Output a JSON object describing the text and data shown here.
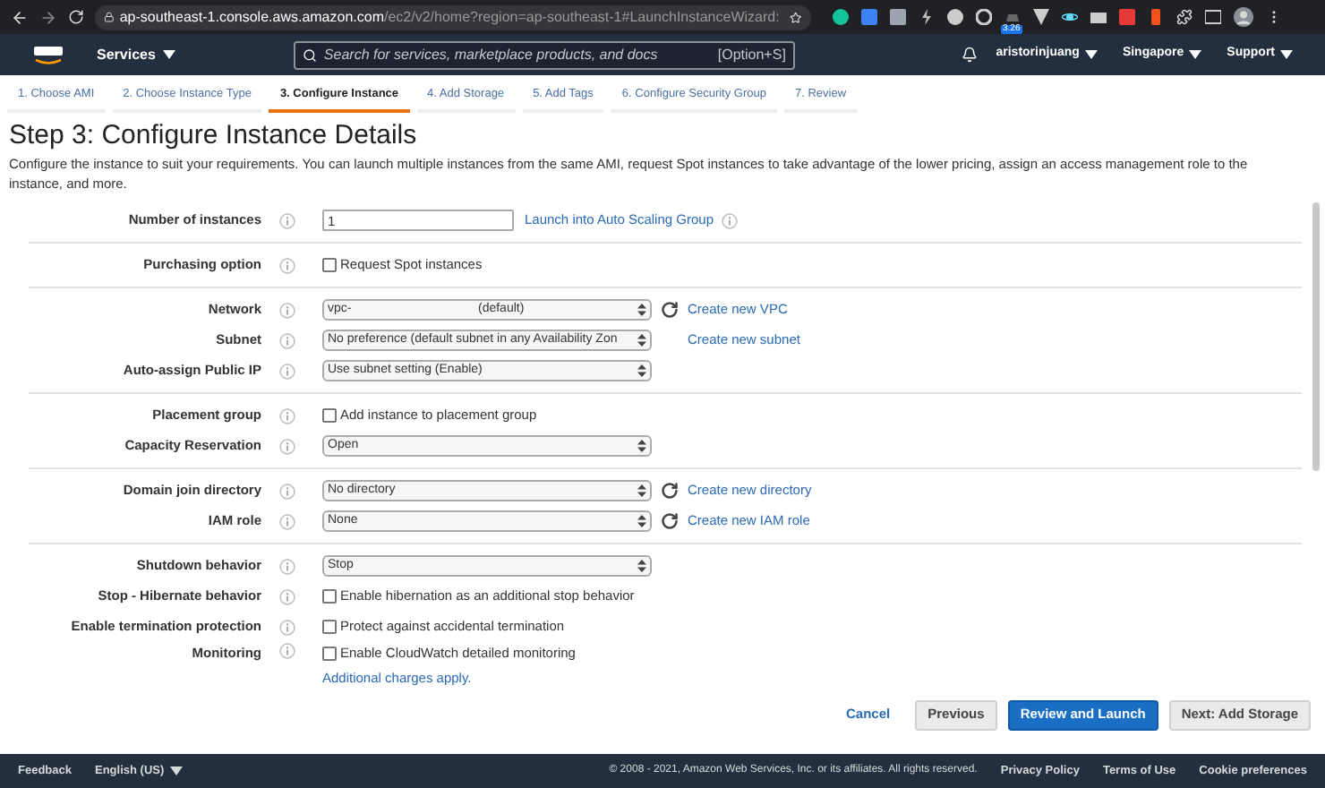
{
  "browser": {
    "url_host": "ap-southeast-1.console.aws.amazon.com",
    "url_path": "/ec2/v2/home?region=ap-southeast-1#LaunchInstanceWizard:",
    "extension_badge": "3.26"
  },
  "top_nav": {
    "services": "Services",
    "search_placeholder": "Search for services, marketplace products, and docs",
    "search_shortcut": "[Option+S]",
    "user": "aristorinjuang",
    "region": "Singapore",
    "support": "Support"
  },
  "wizard_steps": [
    {
      "label": "1. Choose AMI",
      "selected": false
    },
    {
      "label": "2. Choose Instance Type",
      "selected": false
    },
    {
      "label": "3. Configure Instance",
      "selected": true
    },
    {
      "label": "4. Add Storage",
      "selected": false
    },
    {
      "label": "5. Add Tags",
      "selected": false
    },
    {
      "label": "6. Configure Security Group",
      "selected": false
    },
    {
      "label": "7. Review",
      "selected": false
    }
  ],
  "title": "Step 3: Configure Instance Details",
  "description": "Configure the instance to suit your requirements. You can launch multiple instances from the same AMI, request Spot instances to take advantage of the lower pricing, assign an access management role to the instance, and more.",
  "sections": [
    {
      "rows": [
        {
          "label": "Number of instances",
          "kind": "input",
          "value": "1",
          "link": "Launch into Auto Scaling Group",
          "link_info": true
        }
      ]
    },
    {
      "rows": [
        {
          "label": "Purchasing option",
          "kind": "checkbox",
          "text": "Request Spot instances",
          "checked": false
        }
      ]
    },
    {
      "rows": [
        {
          "label": "Network",
          "kind": "select",
          "value": "vpc-",
          "value_suffix": "(default)",
          "refresh": true,
          "link": "Create new VPC"
        },
        {
          "label": "Subnet",
          "kind": "select",
          "value": "No preference (default subnet in any Availability Zon",
          "refresh": false,
          "link": "Create new subnet"
        },
        {
          "label": "Auto-assign Public IP",
          "kind": "select",
          "value": "Use subnet setting (Enable)",
          "refresh": false
        }
      ]
    },
    {
      "rows": [
        {
          "label": "Placement group",
          "kind": "checkbox",
          "text": "Add instance to placement group",
          "checked": false
        },
        {
          "label": "Capacity Reservation",
          "kind": "select",
          "value": "Open",
          "refresh": false
        }
      ]
    },
    {
      "rows": [
        {
          "label": "Domain join directory",
          "kind": "select",
          "value": "No directory",
          "refresh": true,
          "link": "Create new directory"
        },
        {
          "label": "IAM role",
          "kind": "select",
          "value": "None",
          "refresh": true,
          "link": "Create new IAM role"
        }
      ]
    },
    {
      "rows": [
        {
          "label": "Shutdown behavior",
          "kind": "select",
          "value": "Stop",
          "refresh": false
        },
        {
          "label": "Stop - Hibernate behavior",
          "kind": "checkbox",
          "text": "Enable hibernation as an additional stop behavior",
          "checked": false
        },
        {
          "label": "Enable termination protection",
          "kind": "checkbox",
          "text": "Protect against accidental termination",
          "checked": false
        },
        {
          "label": "Monitoring",
          "kind": "checkbox",
          "text": "Enable CloudWatch detailed monitoring",
          "checked": false,
          "note_link": "Additional charges apply."
        }
      ]
    }
  ],
  "actions": [
    {
      "label": "Cancel",
      "kind": "link"
    },
    {
      "label": "Previous",
      "kind": "secondary"
    },
    {
      "label": "Review and Launch",
      "kind": "primary"
    },
    {
      "label": "Next: Add Storage",
      "kind": "secondary"
    }
  ],
  "footer": {
    "feedback": "Feedback",
    "language": "English (US)",
    "copyright": "© 2008 - 2021, Amazon Web Services, Inc. or its affiliates. All rights reserved.",
    "links": [
      "Privacy Policy",
      "Terms of Use",
      "Cookie preferences"
    ]
  }
}
